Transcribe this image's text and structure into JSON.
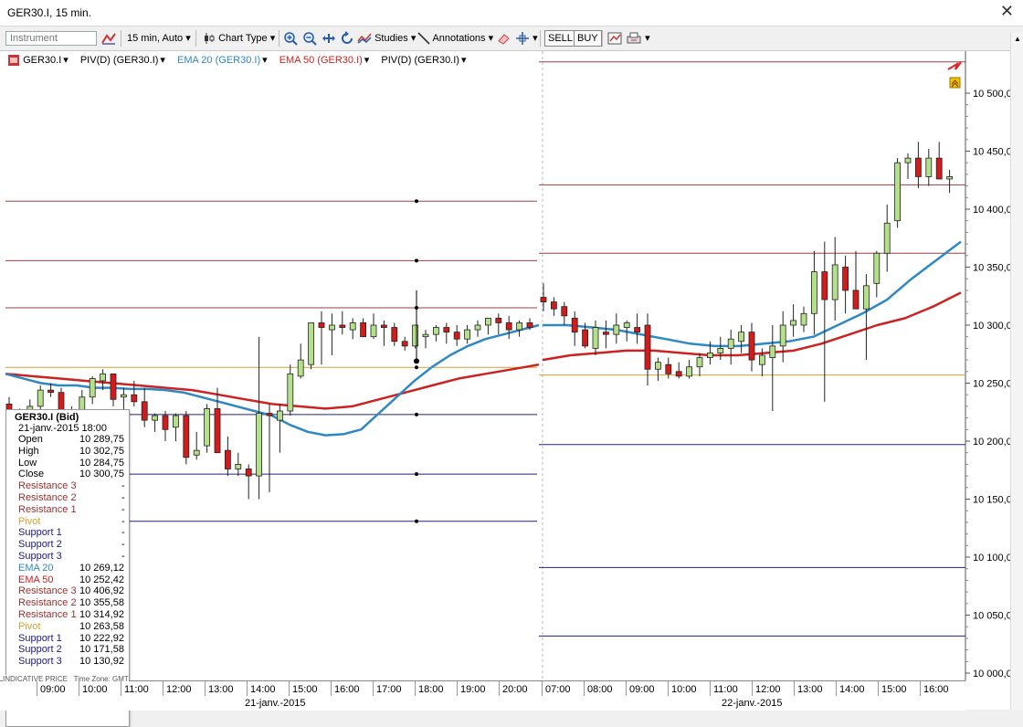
{
  "window": {
    "title": "GER30.I, 15 min.",
    "close_glyph": "✕"
  },
  "toolbar": {
    "instrument_placeholder": "Instrument",
    "interval_label": "15 min, Auto",
    "chart_type_label": "Chart Type",
    "studies_label": "Studies",
    "annotations_label": "Annotations",
    "sell_label": "SELL",
    "buy_label": "BUY"
  },
  "legend": {
    "instrument": "GER30.I",
    "piv1": "PIV(D) (GER30.I)",
    "ema20": "EMA 20 (GER30.I)",
    "ema50": "EMA 50 (GER30.I)",
    "piv2": "PIV(D) (GER30.I)"
  },
  "colors": {
    "bull": "#b5e08a",
    "bear": "#d41b1b",
    "ema20": "#2e88c4",
    "ema50": "#cc2222",
    "resistance": "#9a4040",
    "support": "#222277",
    "pivot": "#d4a030"
  },
  "infobox": {
    "title": "GER30.I (Bid)",
    "datetime": "21-janv.-2015 18:00",
    "rows": [
      {
        "label": "Open",
        "value": "10 289,75",
        "color": "#000"
      },
      {
        "label": "High",
        "value": "10 302,75",
        "color": "#000"
      },
      {
        "label": "Low",
        "value": "10 284,75",
        "color": "#000"
      },
      {
        "label": "Close",
        "value": "10 300,75",
        "color": "#000"
      },
      {
        "label": "Resistance 3",
        "value": "-",
        "color": "#9a3030"
      },
      {
        "label": "Resistance 2",
        "value": "-",
        "color": "#9a3030"
      },
      {
        "label": "Resistance 1",
        "value": "-",
        "color": "#9a3030"
      },
      {
        "label": "Pivot",
        "value": "-",
        "color": "#d4a030"
      },
      {
        "label": "Support 1",
        "value": "-",
        "color": "#1a1a80"
      },
      {
        "label": "Support 2",
        "value": "-",
        "color": "#1a1a80"
      },
      {
        "label": "Support 3",
        "value": "-",
        "color": "#1a1a80"
      },
      {
        "label": "EMA 20",
        "value": "10 269,12",
        "color": "#2e88c4"
      },
      {
        "label": "EMA 50",
        "value": "10 252,42",
        "color": "#cc2222"
      },
      {
        "label": "Resistance 3",
        "value": "10 406,92",
        "color": "#9a3030"
      },
      {
        "label": "Resistance 2",
        "value": "10 355,58",
        "color": "#9a3030"
      },
      {
        "label": "Resistance 1",
        "value": "10 314,92",
        "color": "#9a3030"
      },
      {
        "label": "Pivot",
        "value": "10 263,58",
        "color": "#d4a030"
      },
      {
        "label": "Support 1",
        "value": "10 222,92",
        "color": "#1a1a80"
      },
      {
        "label": "Support 2",
        "value": "10 171,58",
        "color": "#1a1a80"
      },
      {
        "label": "Support 3",
        "value": "10 130,92",
        "color": "#1a1a80"
      }
    ]
  },
  "time_axis": {
    "footer_left": "INDICATIVE PRICE",
    "footer_tz": "Time Zone: GMT",
    "day1": "21-janv.-2015",
    "day2": "22-janv.-2015",
    "ticks": [
      "09:00",
      "10:00",
      "11:00",
      "12:00",
      "13:00",
      "14:00",
      "15:00",
      "16:00",
      "17:00",
      "18:00",
      "19:00",
      "20:00",
      "07:00",
      "08:00",
      "09:00",
      "10:00",
      "11:00",
      "12:00",
      "13:00",
      "14:00",
      "15:00",
      "16:00"
    ]
  },
  "chart_data": {
    "type": "candlestick",
    "y_ticks": [
      "10 500,00",
      "10 450,00",
      "10 400,00",
      "10 350,00",
      "10 300,00",
      "10 250,00",
      "10 200,00",
      "10 150,00",
      "10 100,00",
      "10 050,00",
      "10 000,00"
    ],
    "ylim": [
      10000,
      10500
    ],
    "pivots_day1": {
      "r3": 10406.92,
      "r2": 10355.58,
      "r1": 10314.92,
      "pivot": 10263.58,
      "s1": 10222.92,
      "s2": 10171.58,
      "s3": 10130.92
    },
    "pivots_day2": {
      "r3": 10527,
      "r1": 10421,
      "r2": 10362,
      "pivot": 10257,
      "s1": 10197,
      "s2": 10091,
      "s3": 10032
    },
    "candles_day1": [
      [
        10232,
        10238,
        10210,
        10218
      ],
      [
        10222,
        10228,
        10215,
        10224
      ],
      [
        10224,
        10236,
        10218,
        10230
      ],
      [
        10230,
        10248,
        10226,
        10244
      ],
      [
        10244,
        10250,
        10238,
        10242
      ],
      [
        10242,
        10246,
        10214,
        10220
      ],
      [
        10220,
        10230,
        10212,
        10226
      ],
      [
        10226,
        10244,
        10222,
        10238
      ],
      [
        10238,
        10256,
        10232,
        10254
      ],
      [
        10252,
        10262,
        10244,
        10258
      ],
      [
        10258,
        10256,
        10230,
        10236
      ],
      [
        10238,
        10246,
        10226,
        10240
      ],
      [
        10240,
        10252,
        10230,
        10234
      ],
      [
        10234,
        10246,
        10212,
        10218
      ],
      [
        10218,
        10224,
        10208,
        10222
      ],
      [
        10222,
        10226,
        10200,
        10210
      ],
      [
        10212,
        10224,
        10200,
        10222
      ],
      [
        10222,
        10226,
        10180,
        10186
      ],
      [
        10188,
        10208,
        10184,
        10192
      ],
      [
        10196,
        10232,
        10190,
        10228
      ],
      [
        10228,
        10246,
        10210,
        10190
      ],
      [
        10192,
        10204,
        10170,
        10176
      ],
      [
        10176,
        10190,
        10170,
        10180
      ],
      [
        10176,
        10180,
        10150,
        10170
      ],
      [
        10170,
        10290,
        10150,
        10224
      ],
      [
        10224,
        10232,
        10156,
        10222
      ],
      [
        10218,
        10232,
        10190,
        10226
      ],
      [
        10226,
        10266,
        10222,
        10258
      ],
      [
        10256,
        10284,
        10254,
        10270
      ],
      [
        10266,
        10302,
        10262,
        10302
      ],
      [
        10302,
        10312,
        10266,
        10298
      ],
      [
        10296,
        10310,
        10274,
        10300
      ],
      [
        10300,
        10312,
        10292,
        10298
      ],
      [
        10296,
        10306,
        10288,
        10302
      ],
      [
        10302,
        10306,
        10292,
        10290
      ],
      [
        10290,
        10310,
        10288,
        10300
      ],
      [
        10300,
        10304,
        10282,
        10298
      ],
      [
        10298,
        10302,
        10282,
        10286
      ],
      [
        10286,
        10290,
        10278,
        10282
      ],
      [
        10282,
        10296,
        10280,
        10300
      ],
      [
        10290,
        10296,
        10280,
        10292
      ],
      [
        10292,
        10300,
        10286,
        10298
      ],
      [
        10298,
        10302,
        10284,
        10294
      ],
      [
        10294,
        10300,
        10282,
        10288
      ],
      [
        10288,
        10300,
        10284,
        10296
      ],
      [
        10296,
        10304,
        10290,
        10300
      ],
      [
        10300,
        10306,
        10292,
        10306
      ],
      [
        10306,
        10310,
        10292,
        10302
      ],
      [
        10302,
        10308,
        10288,
        10296
      ],
      [
        10296,
        10304,
        10290,
        10302
      ],
      [
        10302,
        10306,
        10296,
        10298
      ]
    ],
    "candles_day2": [
      [
        10324,
        10336,
        10312,
        10320
      ],
      [
        10320,
        10324,
        10308,
        10314
      ],
      [
        10316,
        10320,
        10300,
        10308
      ],
      [
        10306,
        10312,
        10282,
        10294
      ],
      [
        10296,
        10302,
        10280,
        10282
      ],
      [
        10280,
        10304,
        10274,
        10298
      ],
      [
        10294,
        10304,
        10280,
        10292
      ],
      [
        10292,
        10310,
        10284,
        10300
      ],
      [
        10298,
        10304,
        10286,
        10302
      ],
      [
        10298,
        10310,
        10284,
        10294
      ],
      [
        10300,
        10310,
        10248,
        10262
      ],
      [
        10262,
        10272,
        10252,
        10268
      ],
      [
        10266,
        10272,
        10254,
        10258
      ],
      [
        10260,
        10268,
        10254,
        10256
      ],
      [
        10256,
        10270,
        10254,
        10264
      ],
      [
        10264,
        10276,
        10256,
        10272
      ],
      [
        10272,
        10286,
        10266,
        10276
      ],
      [
        10276,
        10290,
        10270,
        10280
      ],
      [
        10280,
        10296,
        10266,
        10288
      ],
      [
        10286,
        10300,
        10276,
        10294
      ],
      [
        10294,
        10302,
        10260,
        10270
      ],
      [
        10266,
        10280,
        10256,
        10274
      ],
      [
        10272,
        10300,
        10226,
        10282
      ],
      [
        10282,
        10312,
        10268,
        10300
      ],
      [
        10300,
        10318,
        10290,
        10304
      ],
      [
        10300,
        10316,
        10294,
        10310
      ],
      [
        10310,
        10364,
        10292,
        10346
      ],
      [
        10346,
        10372,
        10234,
        10322
      ],
      [
        10322,
        10376,
        10304,
        10352
      ],
      [
        10350,
        10360,
        10310,
        10330
      ],
      [
        10330,
        10364,
        10314,
        10314
      ],
      [
        10314,
        10344,
        10270,
        10334
      ],
      [
        10336,
        10364,
        10324,
        10362
      ],
      [
        10362,
        10404,
        10346,
        10388
      ],
      [
        10390,
        10444,
        10384,
        10440
      ],
      [
        10440,
        10448,
        10426,
        10444
      ],
      [
        10444,
        10458,
        10418,
        10428
      ],
      [
        10428,
        10452,
        10420,
        10444
      ],
      [
        10444,
        10458,
        10426,
        10426
      ],
      [
        10426,
        10434,
        10414,
        10428
      ]
    ],
    "ema20_day1": [
      10258,
      10254,
      10250,
      10248,
      10248,
      10246,
      10246,
      10245,
      10245,
      10244,
      10242,
      10238,
      10234,
      10230,
      10226,
      10222,
      10214,
      10208,
      10205,
      10206,
      10210,
      10224,
      10238,
      10252,
      10264,
      10274,
      10282,
      10288,
      10292,
      10296,
      10300
    ],
    "ema20_day2": [
      10300,
      10300,
      10298,
      10296,
      10292,
      10288,
      10284,
      10282,
      10282,
      10284,
      10286,
      10290,
      10300,
      10310,
      10322,
      10340,
      10356,
      10372
    ],
    "ema50_day1": [
      10258,
      10256,
      10254,
      10252,
      10250,
      10248,
      10246,
      10244,
      10240,
      10236,
      10232,
      10230,
      10228,
      10230,
      10236,
      10242,
      10248,
      10254,
      10258,
      10262,
      10266
    ],
    "ema50_day2": [
      10270,
      10274,
      10276,
      10278,
      10278,
      10276,
      10274,
      10274,
      10276,
      10278,
      10284,
      10292,
      10300,
      10306,
      10316,
      10328
    ]
  }
}
